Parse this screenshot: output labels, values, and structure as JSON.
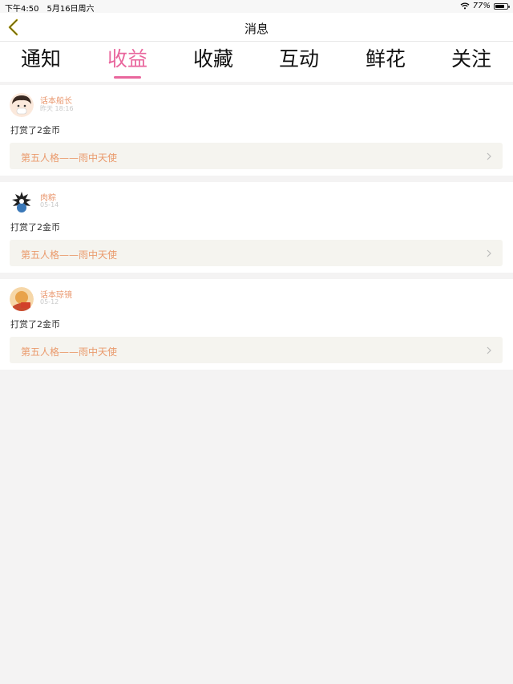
{
  "status_bar": {
    "time": "下午4:50",
    "date": "5月16日周六",
    "battery": "77%"
  },
  "nav": {
    "title": "消息"
  },
  "tabs": [
    {
      "label": "通知"
    },
    {
      "label": "收益"
    },
    {
      "label": "收藏"
    },
    {
      "label": "互动"
    },
    {
      "label": "鲜花"
    },
    {
      "label": "关注"
    }
  ],
  "active_tab": "收益",
  "messages": [
    {
      "user": "话本船长",
      "time": "昨天 18:16",
      "text": "打赏了2金币",
      "work": "第五人格——雨中天使"
    },
    {
      "user": "肉粽",
      "time": "05-14",
      "text": "打赏了2金币",
      "work": "第五人格——雨中天使"
    },
    {
      "user": "话本琼镜",
      "time": "05-12",
      "text": "打赏了2金币",
      "work": "第五人格——雨中天使"
    }
  ],
  "colors": {
    "accent": "#e9669d",
    "name": "#e9976e",
    "link_bg": "#f5f4ef",
    "page_bg": "#f4f3f3"
  },
  "icons": {
    "back": "chevron-left-icon",
    "row": "chevron-right-icon",
    "wifi": "wifi-icon",
    "battery": "battery-icon"
  }
}
